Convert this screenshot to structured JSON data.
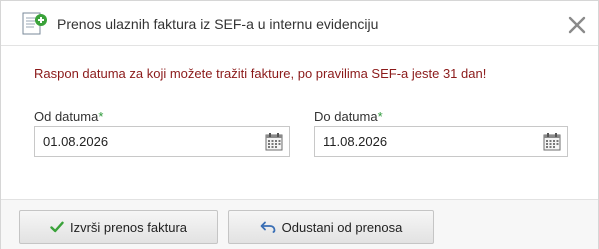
{
  "dialog": {
    "title": "Prenos ulaznih faktura iz SEF-a u internu evidenciju",
    "title_icon": "add-document-icon",
    "close_icon": "close-icon"
  },
  "warning": {
    "text": "Raspon datuma za koji možete tražiti fakture, po pravilima SEF-a jeste 31 dan!",
    "color": "#8b1a1a"
  },
  "date_from": {
    "label": "Od datuma",
    "required_mark": "*",
    "value": "01.08.2026",
    "icon": "calendar-icon"
  },
  "date_to": {
    "label": "Do datuma",
    "required_mark": "*",
    "value": "11.08.2026",
    "icon": "calendar-icon"
  },
  "footer": {
    "execute_label": "Izvrši prenos faktura",
    "execute_icon": "checkmark-icon",
    "cancel_label": "Odustani od prenosa",
    "cancel_icon": "undo-arrow-icon"
  },
  "colors": {
    "required": "#2e9a3a",
    "checkmark": "#3aa23a",
    "undo_arrow": "#3a6fb5"
  }
}
